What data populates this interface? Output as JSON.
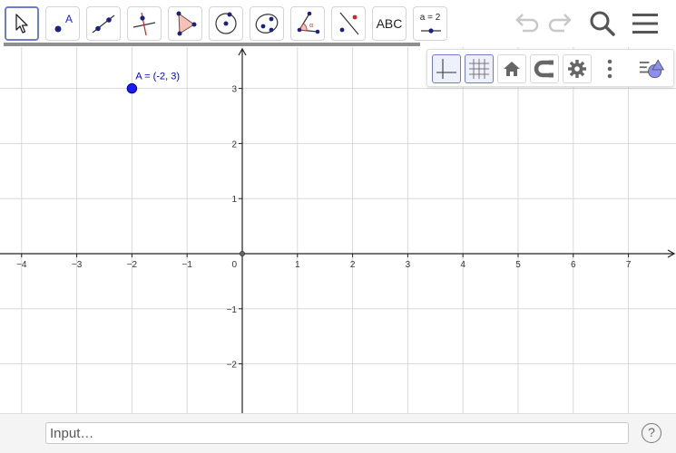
{
  "toolbar": {
    "tools": [
      {
        "name": "move",
        "icon": "move-arrow-icon",
        "selected": true
      },
      {
        "name": "point",
        "icon": "point-icon"
      },
      {
        "name": "line",
        "icon": "line-through-two-points-icon"
      },
      {
        "name": "perpendicular-line",
        "icon": "perpendicular-line-icon"
      },
      {
        "name": "polygon",
        "icon": "polygon-icon"
      },
      {
        "name": "circle",
        "icon": "circle-center-point-icon"
      },
      {
        "name": "ellipse",
        "icon": "ellipse-icon"
      },
      {
        "name": "angle",
        "icon": "angle-icon"
      },
      {
        "name": "reflect",
        "icon": "reflect-about-line-icon"
      },
      {
        "name": "text",
        "icon": "text-icon",
        "label": "ABC"
      },
      {
        "name": "slider",
        "icon": "slider-icon",
        "label": "a = 2"
      }
    ],
    "undo_icon": "undo-icon",
    "redo_icon": "redo-icon",
    "search_icon": "search-icon",
    "menu_icon": "hamburger-menu-icon"
  },
  "style_bar": {
    "buttons": [
      {
        "name": "axes-toggle",
        "icon": "axes-icon",
        "active": true
      },
      {
        "name": "grid-toggle",
        "icon": "grid-icon",
        "active": true
      },
      {
        "name": "standard-view",
        "icon": "home-icon"
      },
      {
        "name": "point-capturing",
        "icon": "magnet-icon"
      },
      {
        "name": "graphics-settings",
        "icon": "gear-icon"
      },
      {
        "name": "more-options",
        "icon": "vertical-dots-icon"
      },
      {
        "name": "toggle-style-bar",
        "icon": "style-bar-toggle-icon"
      }
    ]
  },
  "graphics": {
    "x_ticks": [
      -4,
      -3,
      -2,
      -1,
      0,
      1,
      2,
      3,
      4,
      5,
      6,
      7
    ],
    "y_ticks": [
      -2,
      -1,
      1,
      2,
      3
    ],
    "point": {
      "name": "A",
      "x": -2,
      "y": 3,
      "label": "A = (-2, 3)"
    },
    "colors": {
      "grid": "#d9d9d9",
      "axis": "#222222",
      "point": "#1a1aff",
      "label": "#0000cc"
    }
  },
  "input_bar": {
    "placeholder": "Input…",
    "value": "",
    "help_label": "?"
  }
}
